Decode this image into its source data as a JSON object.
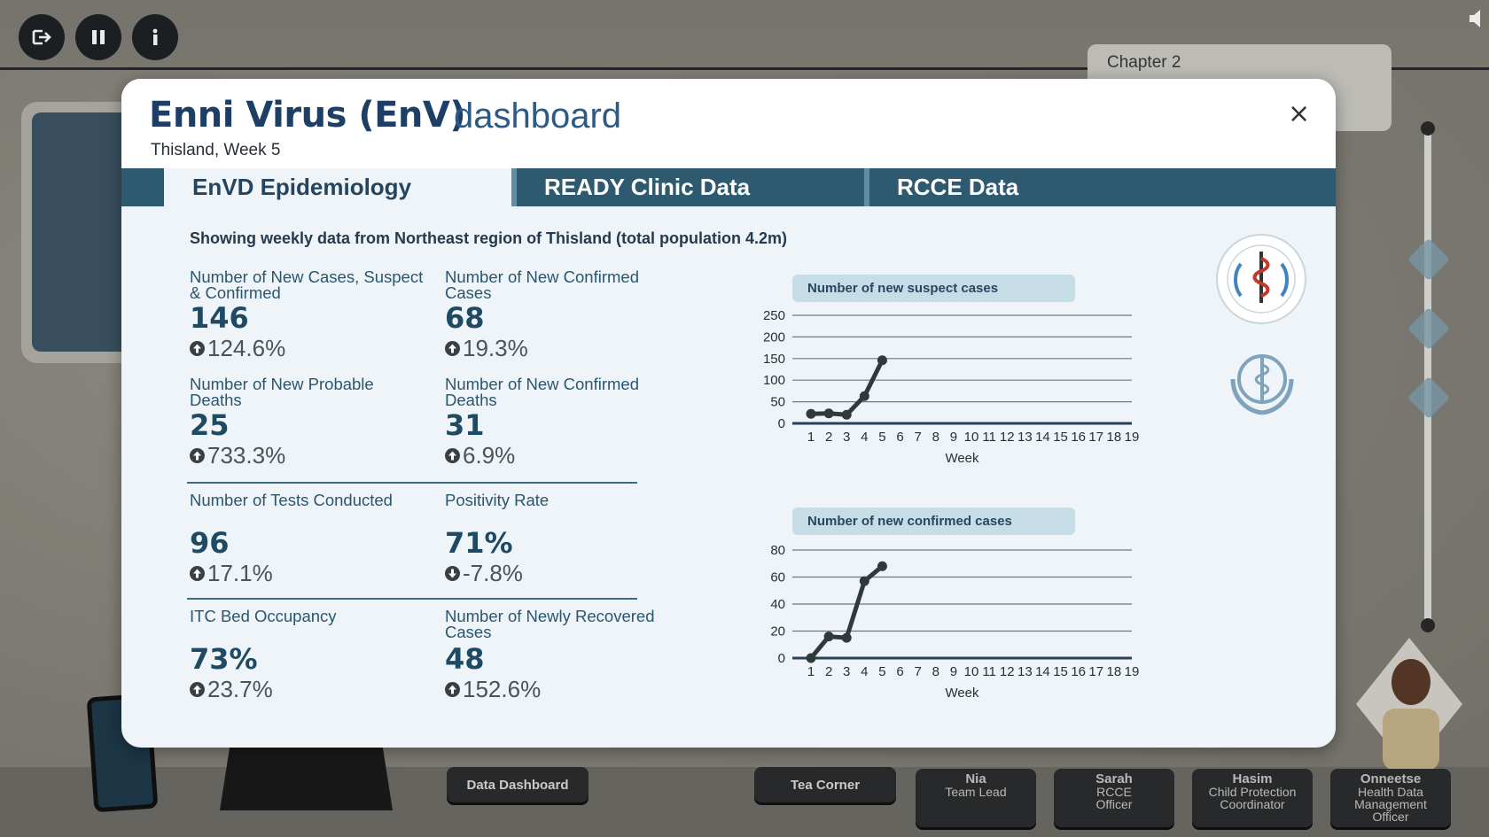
{
  "app": {
    "chapter": "Chapter 2",
    "bottom_buttons": {
      "data_dashboard": "Data Dashboard",
      "tea_corner": "Tea Corner"
    },
    "characters": [
      {
        "name": "Nia",
        "role": "Team Lead"
      },
      {
        "name": "Sarah",
        "role": "RCCE Officer"
      },
      {
        "name": "Hasim",
        "role": "Child Protection Coordinator"
      },
      {
        "name": "Onneetse",
        "role": "Health Data Management Officer"
      }
    ],
    "top_icons": [
      "exit-icon",
      "pause-icon",
      "info-icon"
    ]
  },
  "dashboard": {
    "title_bold": "Enni Virus (EnV)",
    "title_light": "dashboard",
    "subtitle": "Thisland, Week 5",
    "close_label": "×",
    "tabs": [
      {
        "label": "EnVD Epidemiology",
        "active": true
      },
      {
        "label": "READY Clinic Data",
        "active": false
      },
      {
        "label": "RCCE Data",
        "active": false
      }
    ],
    "note": "Showing weekly data from Northeast region of Thisland (total population 4.2m)",
    "stats": [
      {
        "label": "Number of New Cases, Suspect & Confirmed",
        "value": "146",
        "change": "124.6%",
        "direction": "up"
      },
      {
        "label": "Number of New Confirmed Cases",
        "value": "68",
        "change": "19.3%",
        "direction": "up"
      },
      {
        "label": "Number of New Probable Deaths",
        "value": "25",
        "change": "733.3%",
        "direction": "up"
      },
      {
        "label": "Number of New Confirmed Deaths",
        "value": "31",
        "change": "6.9%",
        "direction": "up"
      },
      {
        "label": "Number of Tests Conducted",
        "value": "96",
        "change": "17.1%",
        "direction": "up"
      },
      {
        "label": "Positivity Rate",
        "value": "71%",
        "change": "-7.8%",
        "direction": "down"
      },
      {
        "label": "ITC Bed Occupancy",
        "value": "73%",
        "change": "23.7%",
        "direction": "up"
      },
      {
        "label": "Number of Newly Recovered Cases",
        "value": "48",
        "change": "152.6%",
        "direction": "up"
      }
    ],
    "colors": {
      "primary": "#1f4a63",
      "tabbar": "#2e5a70",
      "panel": "#eef4f7",
      "line": "#2f3a3c"
    }
  },
  "chart_data": [
    {
      "type": "line",
      "title": "Number of new suspect cases",
      "xlabel": "Week",
      "x": [
        1,
        2,
        3,
        4,
        5,
        6,
        7,
        8,
        9,
        10,
        11,
        12,
        13,
        14,
        15,
        16,
        17,
        18,
        19
      ],
      "y_ticks": [
        0,
        50,
        100,
        150,
        200,
        250
      ],
      "ylim": [
        0,
        250
      ],
      "series": [
        {
          "x": [
            1,
            2,
            3,
            4,
            5
          ],
          "values": [
            22,
            23,
            20,
            63,
            146
          ]
        }
      ],
      "grid": true
    },
    {
      "type": "line",
      "title": "Number of new confirmed cases",
      "xlabel": "Week",
      "x": [
        1,
        2,
        3,
        4,
        5,
        6,
        7,
        8,
        9,
        10,
        11,
        12,
        13,
        14,
        15,
        16,
        17,
        18,
        19
      ],
      "y_ticks": [
        0,
        20,
        40,
        60,
        80
      ],
      "ylim": [
        0,
        80
      ],
      "series": [
        {
          "x": [
            1,
            2,
            3,
            4,
            5
          ],
          "values": [
            0,
            16,
            15,
            57,
            68
          ]
        }
      ],
      "grid": true
    }
  ]
}
